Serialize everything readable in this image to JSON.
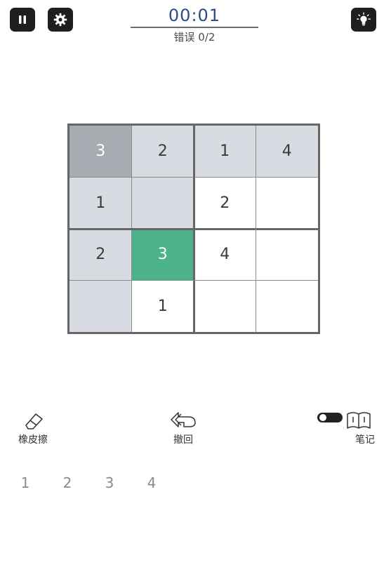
{
  "header": {
    "pause_icon": "pause-icon",
    "settings_icon": "gear-icon",
    "hint_icon": "lightbulb-icon",
    "timer": "00:01",
    "errors": "错误 0/2"
  },
  "board": {
    "size": 4,
    "cells": [
      {
        "row": 0,
        "col": 0,
        "value": "3",
        "state": "selected"
      },
      {
        "row": 0,
        "col": 1,
        "value": "2",
        "state": "given"
      },
      {
        "row": 0,
        "col": 2,
        "value": "1",
        "state": "given"
      },
      {
        "row": 0,
        "col": 3,
        "value": "4",
        "state": "given"
      },
      {
        "row": 1,
        "col": 0,
        "value": "1",
        "state": "given"
      },
      {
        "row": 1,
        "col": 1,
        "value": "",
        "state": "given"
      },
      {
        "row": 1,
        "col": 2,
        "value": "2",
        "state": "empty"
      },
      {
        "row": 1,
        "col": 3,
        "value": "",
        "state": "empty"
      },
      {
        "row": 2,
        "col": 0,
        "value": "2",
        "state": "given"
      },
      {
        "row": 2,
        "col": 1,
        "value": "3",
        "state": "correct"
      },
      {
        "row": 2,
        "col": 2,
        "value": "4",
        "state": "empty"
      },
      {
        "row": 2,
        "col": 3,
        "value": "",
        "state": "empty"
      },
      {
        "row": 3,
        "col": 0,
        "value": "",
        "state": "given"
      },
      {
        "row": 3,
        "col": 1,
        "value": "1",
        "state": "empty"
      },
      {
        "row": 3,
        "col": 2,
        "value": "",
        "state": "empty"
      },
      {
        "row": 3,
        "col": 3,
        "value": "",
        "state": "empty"
      }
    ]
  },
  "toolbar": {
    "eraser_label": "橡皮擦",
    "eraser_icon": "eraser-icon",
    "undo_label": "撤回",
    "undo_icon": "undo-icon",
    "notes_label": "笔记",
    "notes_icon": "notebook-icon",
    "notes_toggle": false
  },
  "numpad": [
    "1",
    "2",
    "3",
    "4"
  ],
  "colors": {
    "given": "#d9dbe3",
    "selected": "#a9abb2",
    "correct": "#4cb38c",
    "timer": "#2d4d86"
  }
}
